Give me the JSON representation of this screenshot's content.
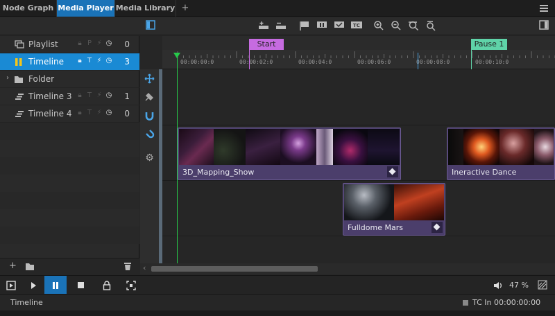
{
  "tabs": [
    {
      "label": "Node Graph",
      "active": false
    },
    {
      "label": "Media Player",
      "active": true
    },
    {
      "label": "Media Library",
      "active": false
    }
  ],
  "tab_add": "+",
  "list_items": [
    {
      "name": "Playlist",
      "flags": [
        "lock",
        "P",
        "bolt",
        "clock"
      ],
      "count": "0",
      "icon": "playlist-icon",
      "selected": false
    },
    {
      "name": "Timeline",
      "flags": [
        "lock",
        "T",
        "bolt",
        "clock"
      ],
      "count": "3",
      "icon": "pause-icon",
      "selected": true
    },
    {
      "name": "Folder",
      "flags": [],
      "count": "",
      "icon": "folder-icon",
      "selected": false
    },
    {
      "name": "Timeline 3",
      "flags": [
        "lock",
        "T",
        "bolt",
        "clock"
      ],
      "count": "1",
      "icon": "timeline-icon",
      "selected": false
    },
    {
      "name": "Timeline 4",
      "flags": [
        "lock",
        "T",
        "bolt",
        "clock"
      ],
      "count": "0",
      "icon": "timeline-icon",
      "selected": false
    }
  ],
  "left_bottom": {
    "add": "+"
  },
  "ruler_ticks": [
    "00:00:00:0",
    "00:00:02:0",
    "00:00:04:0",
    "00:00:06:0",
    "00:00:08:0",
    "00:00:10:0"
  ],
  "markers": [
    {
      "label": "Start",
      "color": "#c66be0"
    },
    {
      "label": "Pause 1",
      "color": "#5fd3a8"
    }
  ],
  "clips": [
    {
      "name": "3D_Mapping_Show"
    },
    {
      "name": "Ineractive Dance"
    },
    {
      "name": "Fulldome Mars"
    }
  ],
  "transport": {
    "volume": "47 %"
  },
  "status": {
    "left": "Timeline",
    "tc_label": "TC In",
    "tc_value": "00:00:00:00"
  }
}
